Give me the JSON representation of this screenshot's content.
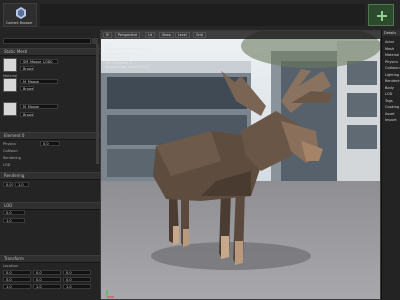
{
  "toolbar": {
    "content_browser_label": "Content Browser",
    "right_icon_name": "play-icon"
  },
  "left_panel": {
    "search_placeholder": "",
    "static_mesh_label": "Static Mesh",
    "material_label": "Material",
    "section_labels": [
      "Element 0",
      "Physics",
      "Collision",
      "Rendering",
      "LOD",
      "Transform"
    ],
    "mesh_value": "SM_Moose_LOD0",
    "material_value": "M_Moose",
    "browse_label": "Browse",
    "field_values": [
      "0.0",
      "0.0",
      "0.0",
      "1.0",
      "1.0",
      "1.0"
    ],
    "transform_rows": [
      "Location",
      "Rotation",
      "Scale"
    ],
    "transform_values": [
      [
        "0.0",
        "0.0",
        "0.0"
      ],
      [
        "0.0",
        "0.0",
        "0.0"
      ],
      [
        "1.0",
        "1.0",
        "1.0"
      ]
    ]
  },
  "viewport": {
    "buttons": [
      "Perspective",
      "Lit",
      "Show",
      "Level",
      "Grid"
    ],
    "stats": [
      "LOD: 0",
      "Current Screen Size: 1.00",
      "Triangles: 2,214",
      "Vertices: 1,516",
      "UV Channels: 1",
      "Approx Size: 184x75x213"
    ]
  },
  "right_panel": {
    "header": "Details",
    "items": [
      "Actor",
      "Mesh",
      "Material",
      "Physics",
      "Collision",
      "Lighting",
      "Rendering",
      "Body",
      "LOD",
      "Tags",
      "Cooking",
      "Asset",
      "Import"
    ]
  }
}
